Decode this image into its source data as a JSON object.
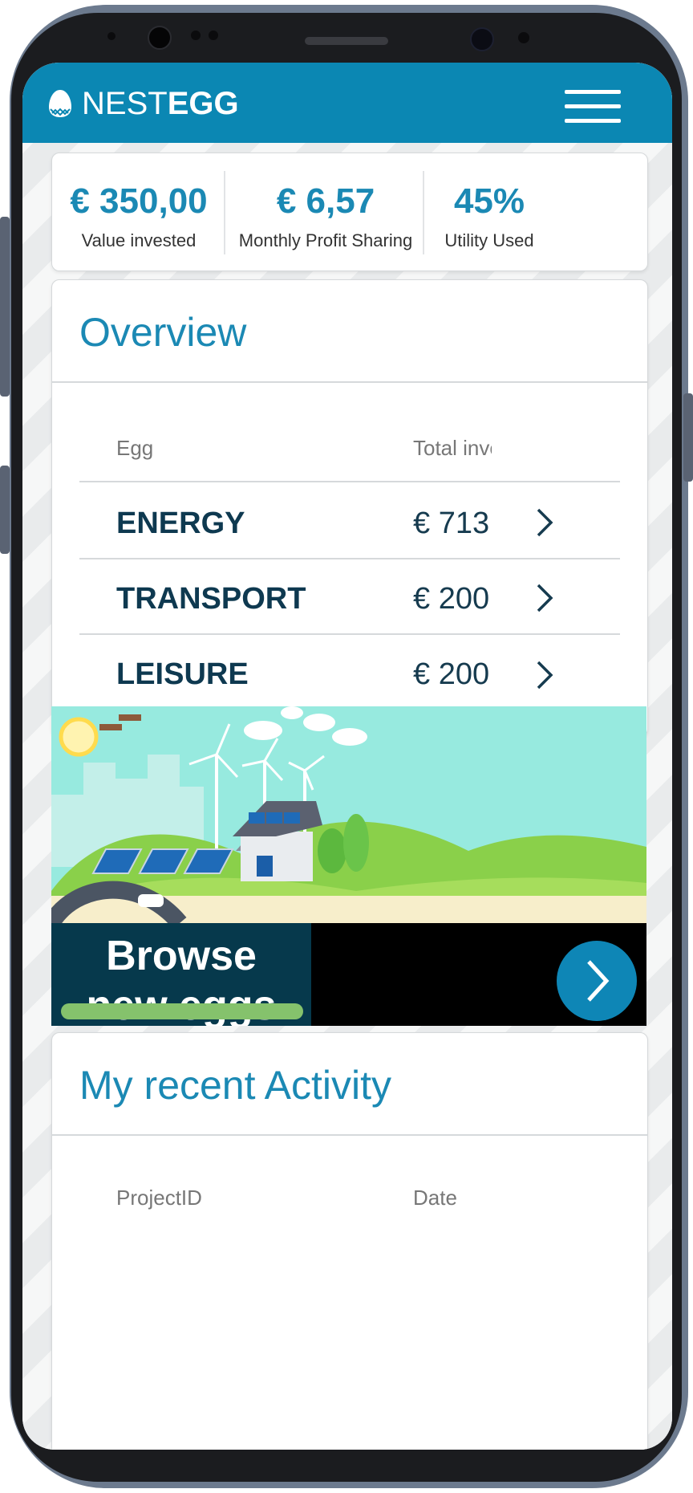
{
  "app": {
    "logo_light": "NEST",
    "logo_bold": "EGG"
  },
  "stats": [
    {
      "value": "€ 350,00",
      "label": "Value invested"
    },
    {
      "value": "€ 6,57",
      "label": "Monthly Profit Sharing"
    },
    {
      "value": "45%",
      "label": "Utility Used"
    }
  ],
  "overview": {
    "title": "Overview",
    "columns": [
      "Egg",
      "Total inve"
    ],
    "rows": [
      {
        "name": "ENERGY",
        "total": "€ 713,"
      },
      {
        "name": "TRANSPORT",
        "total": "€ 200,"
      },
      {
        "name": "LEISURE",
        "total": "€ 200,"
      }
    ]
  },
  "banner": {
    "line1": "Browse",
    "line2": "new eggs"
  },
  "activity": {
    "title": "My recent Activity",
    "columns": [
      "ProjectID",
      "Date"
    ]
  },
  "colors": {
    "brand": "#0b87b3",
    "accent_text": "#1b89b4",
    "dark_navy": "#06394c",
    "green": "#85c26c"
  },
  "icons": [
    "egg-logo-icon",
    "hamburger-menu-icon",
    "chevron-right-icon",
    "arrow-circle-icon"
  ]
}
